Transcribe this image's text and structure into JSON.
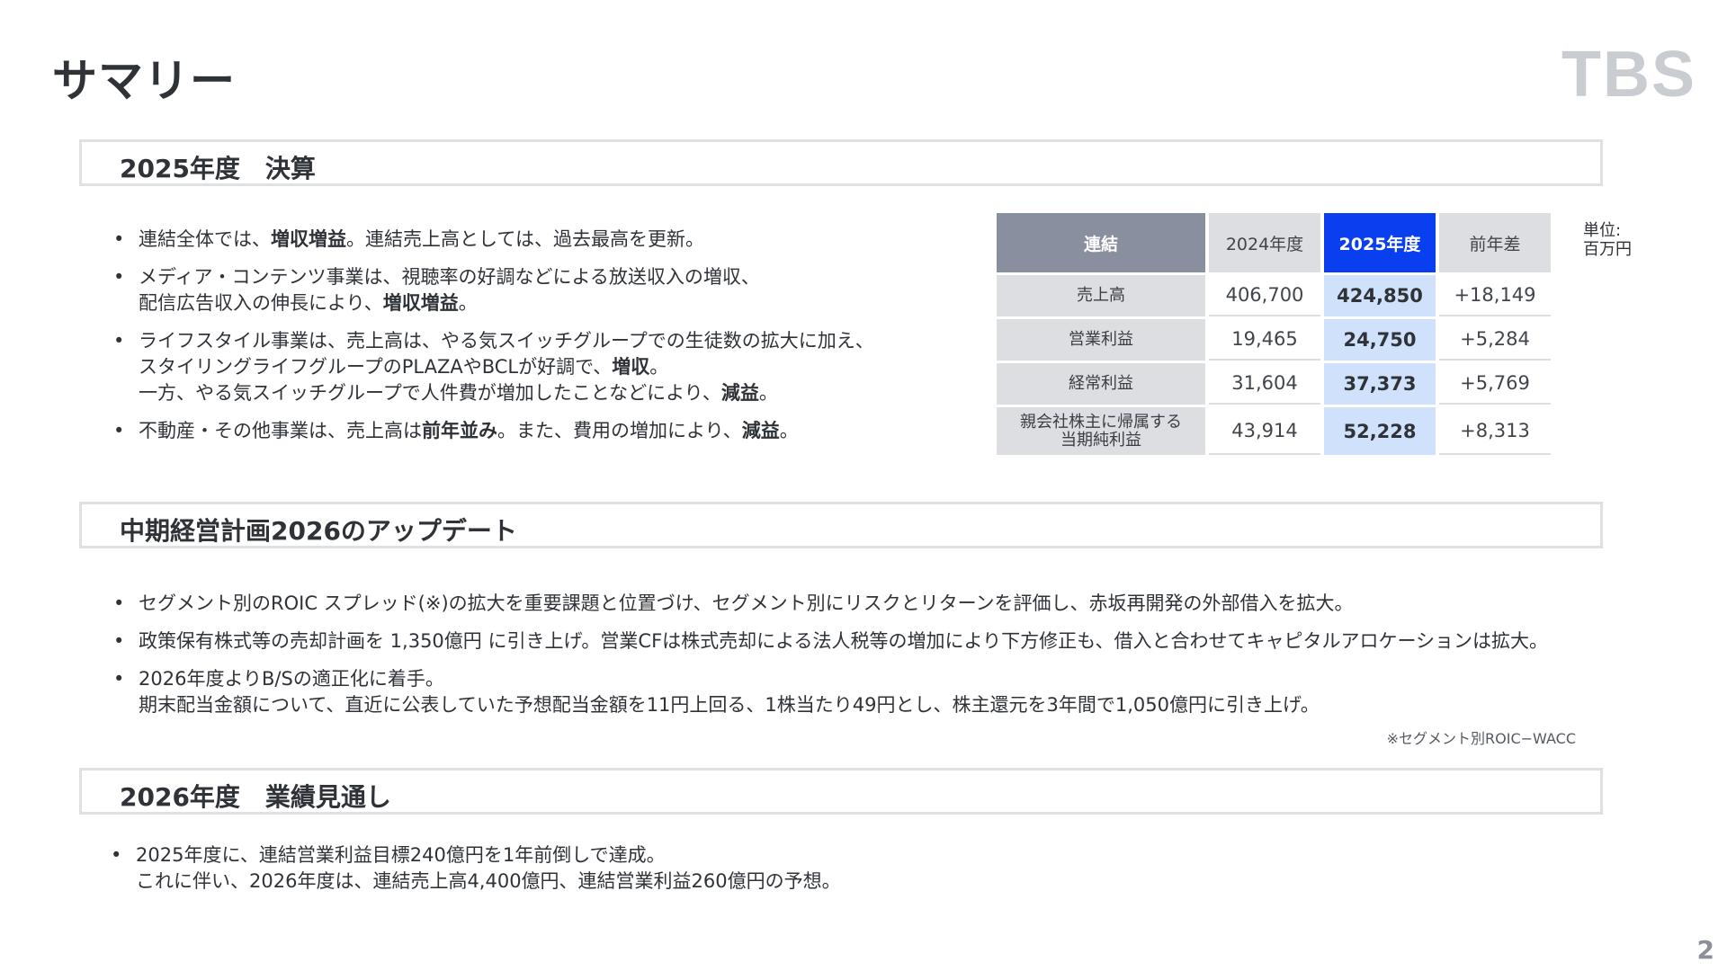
{
  "page": {
    "title": "サマリー",
    "logo": "TBS",
    "number": "2"
  },
  "section1": {
    "title": "2025年度　決算",
    "bullets": [
      [
        [
          "連結全体では、",
          "増収増益",
          "。連結売上高としては、過去最高を更新。"
        ]
      ],
      [
        [
          "メディア・コンテンツ事業は、視聴率の好調などによる放送収入の増収、"
        ],
        [
          "配信広告収入の伸長により、",
          "増収増益",
          "。"
        ]
      ],
      [
        [
          "ライフスタイル事業は、売上高は、やる気スイッチグループでの生徒数の拡大に加え、"
        ],
        [
          "スタイリングライフグループのPLAZAやBCLが好調で、",
          "増収",
          "。"
        ],
        [
          "一方、やる気スイッチグループで人件費が増加したことなどにより、",
          "減益",
          "。"
        ]
      ],
      [
        [
          "不動産・その他事業は、売上高は",
          "前年並み",
          "。また、費用の増加により、",
          "減益",
          "。"
        ]
      ]
    ],
    "table": {
      "headers": [
        "連結",
        "2024年度",
        "2025年度",
        "前年差"
      ],
      "rows": [
        {
          "label": [
            "売上高"
          ],
          "prev": "406,700",
          "cur": "424,850",
          "diff": "+18,149"
        },
        {
          "label": [
            "営業利益"
          ],
          "prev": "19,465",
          "cur": "24,750",
          "diff": "+5,284"
        },
        {
          "label": [
            "経常利益"
          ],
          "prev": "31,604",
          "cur": "37,373",
          "diff": "+5,769"
        },
        {
          "label": [
            "親会社株主に帰属する",
            "当期純利益"
          ],
          "prev": "43,914",
          "cur": "52,228",
          "diff": "+8,313"
        }
      ],
      "unit": [
        "単位:",
        "百万円"
      ]
    }
  },
  "section2": {
    "title": "中期経営計画2026のアップデート",
    "bullets": [
      [
        [
          "セグメント別のROIC スプレッド(※)の拡大を重要課題と位置づけ、セグメント別にリスクとリターンを評価し、赤坂再開発の外部借入を拡大。"
        ]
      ],
      [
        [
          "政策保有株式等の売却計画を 1,350億円 に引き上げ。営業CFは株式売却による法人税等の増加により下方修正も、借入と合わせてキャピタルアロケーションは拡大。"
        ]
      ],
      [
        [
          "2026年度よりB/Sの適正化に着手。"
        ],
        [
          "期末配当金額について、直近に公表していた予想配当金額を11円上回る、1株当たり49円とし、株主還元を3年間で1,050億円に引き上げ。"
        ]
      ]
    ],
    "note": "※セグメント別ROIC−WACC"
  },
  "section3": {
    "title": "2026年度　業績見通し",
    "bullets": [
      [
        [
          "2025年度に、連結営業利益目標240億円を1年前倒しで達成。"
        ],
        [
          "これに伴い、2026年度は、連結売上高4,400億円、連結営業利益260億円の予想。"
        ]
      ]
    ]
  }
}
